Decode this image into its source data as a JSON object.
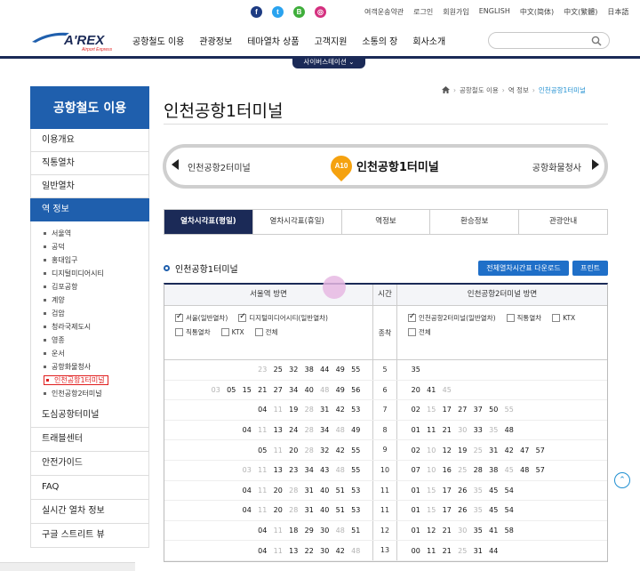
{
  "sns": {
    "facebook": {
      "glyph": "f",
      "color": "#1d3b82"
    },
    "twitter": {
      "glyph": "t",
      "color": "#2aa3ef"
    },
    "blog": {
      "glyph": "B",
      "color": "#3fae3b"
    },
    "instagram": {
      "glyph": "◎",
      "color": "#d4307f"
    }
  },
  "util_links": [
    "여객운송약관",
    "로그인",
    "회원가입",
    "ENGLISH",
    "中文(简体)",
    "中文(繁體)",
    "日本語"
  ],
  "logo": {
    "text": "A'REX",
    "sub": "Airport Express"
  },
  "gnb": [
    "공항철도 이용",
    "관광정보",
    "테마열차 상품",
    "고객지원",
    "소통의 장",
    "회사소개"
  ],
  "search": {
    "placeholder": ""
  },
  "cyber_station": "사이버스테이션",
  "sidebar": {
    "title": "공항철도 이용",
    "items_top": [
      "이용개요",
      "직통열차",
      "일반열차"
    ],
    "active": "역 정보",
    "stations": [
      "서울역",
      "공덕",
      "홍대입구",
      "디지털미디어시티",
      "김포공항",
      "계양",
      "검암",
      "청라국제도시",
      "영종",
      "운서",
      "공항화물청사",
      "인천공항1터미널",
      "인천공항2터미널"
    ],
    "current_station": "인천공항1터미널",
    "items_bottom": [
      "도심공항터미널",
      "트래블센터",
      "안전가이드",
      "FAQ",
      "실시간 열차 정보",
      "구글 스트리트 뷰"
    ]
  },
  "breadcrumb": [
    "공항철도 이용",
    "역 정보",
    "인천공항1터미널"
  ],
  "page_title": "인천공항1터미널",
  "station_nav": {
    "prev": "인천공항2터미널",
    "code": "A10",
    "current": "인천공항1터미널",
    "next": "공항화물청사"
  },
  "tabs": [
    "열차시각표(평일)",
    "열차시각표(휴일)",
    "역정보",
    "환승정보",
    "관광안내"
  ],
  "section_title": "인천공항1터미널",
  "buttons": {
    "download": "전체열차시간표 다운로드",
    "print": "프린트"
  },
  "timetable": {
    "left_header": "서울역 방면",
    "mid_header": "시간",
    "right_header": "인천공항2터미널 방면",
    "mid_filter": "종착",
    "left_filters": [
      {
        "label": "서울(일반열차)",
        "checked": true
      },
      {
        "label": "디지털미디어시티(일반열차)",
        "checked": true
      },
      {
        "label": "직통열차",
        "checked": false
      },
      {
        "label": "KTX",
        "checked": false
      },
      {
        "label": "전체",
        "checked": false
      }
    ],
    "right_filters": [
      {
        "label": "인천공항2터미널(일반열차)",
        "checked": true
      },
      {
        "label": "직통열차",
        "checked": false
      },
      {
        "label": "KTX",
        "checked": false
      },
      {
        "label": "전체",
        "checked": false
      }
    ],
    "rows": [
      {
        "hour": "5",
        "left": [
          {
            "v": "23",
            "g": true
          },
          {
            "v": "25"
          },
          {
            "v": "32"
          },
          {
            "v": "38"
          },
          {
            "v": "44"
          },
          {
            "v": "49"
          },
          {
            "v": "55"
          }
        ],
        "right": [
          {
            "v": "35"
          }
        ]
      },
      {
        "hour": "6",
        "left": [
          {
            "v": "03",
            "g": true
          },
          {
            "v": "05"
          },
          {
            "v": "15"
          },
          {
            "v": "21"
          },
          {
            "v": "27"
          },
          {
            "v": "34"
          },
          {
            "v": "40"
          },
          {
            "v": "48",
            "g": true
          },
          {
            "v": "49"
          },
          {
            "v": "56"
          }
        ],
        "right": [
          {
            "v": "20"
          },
          {
            "v": "41"
          },
          {
            "v": "45",
            "g": true
          }
        ]
      },
      {
        "hour": "7",
        "left": [
          {
            "v": "04"
          },
          {
            "v": "11",
            "g": true
          },
          {
            "v": "19"
          },
          {
            "v": "28",
            "g": true
          },
          {
            "v": "31"
          },
          {
            "v": "42"
          },
          {
            "v": "53"
          }
        ],
        "right": [
          {
            "v": "02"
          },
          {
            "v": "15",
            "g": true
          },
          {
            "v": "17"
          },
          {
            "v": "27"
          },
          {
            "v": "37"
          },
          {
            "v": "50"
          },
          {
            "v": "55",
            "g": true
          }
        ]
      },
      {
        "hour": "8",
        "left": [
          {
            "v": "04"
          },
          {
            "v": "11",
            "g": true
          },
          {
            "v": "13"
          },
          {
            "v": "24"
          },
          {
            "v": "28",
            "g": true
          },
          {
            "v": "34"
          },
          {
            "v": "48",
            "g": true
          },
          {
            "v": "49"
          }
        ],
        "right": [
          {
            "v": "01"
          },
          {
            "v": "11"
          },
          {
            "v": "21"
          },
          {
            "v": "30",
            "g": true
          },
          {
            "v": "33"
          },
          {
            "v": "35",
            "g": true
          },
          {
            "v": "48"
          }
        ]
      },
      {
        "hour": "9",
        "left": [
          {
            "v": "05"
          },
          {
            "v": "11",
            "g": true
          },
          {
            "v": "20"
          },
          {
            "v": "28",
            "g": true
          },
          {
            "v": "32"
          },
          {
            "v": "42"
          },
          {
            "v": "55"
          }
        ],
        "right": [
          {
            "v": "02"
          },
          {
            "v": "10",
            "g": true
          },
          {
            "v": "12"
          },
          {
            "v": "19"
          },
          {
            "v": "25",
            "g": true
          },
          {
            "v": "31"
          },
          {
            "v": "42"
          },
          {
            "v": "47"
          },
          {
            "v": "57"
          }
        ]
      },
      {
        "hour": "10",
        "left": [
          {
            "v": "03",
            "g": true
          },
          {
            "v": "11",
            "g": true
          },
          {
            "v": "13"
          },
          {
            "v": "23"
          },
          {
            "v": "34"
          },
          {
            "v": "43"
          },
          {
            "v": "48",
            "g": true
          },
          {
            "v": "55"
          }
        ],
        "right": [
          {
            "v": "07"
          },
          {
            "v": "10",
            "g": true
          },
          {
            "v": "16"
          },
          {
            "v": "25",
            "g": true
          },
          {
            "v": "28"
          },
          {
            "v": "38"
          },
          {
            "v": "45",
            "g": true
          },
          {
            "v": "48"
          },
          {
            "v": "57"
          }
        ]
      },
      {
        "hour": "11",
        "left": [
          {
            "v": "04"
          },
          {
            "v": "11",
            "g": true
          },
          {
            "v": "20"
          },
          {
            "v": "28",
            "g": true
          },
          {
            "v": "31"
          },
          {
            "v": "40"
          },
          {
            "v": "51"
          },
          {
            "v": "53"
          }
        ],
        "right": [
          {
            "v": "01"
          },
          {
            "v": "15",
            "g": true
          },
          {
            "v": "17"
          },
          {
            "v": "26"
          },
          {
            "v": "35",
            "g": true
          },
          {
            "v": "45"
          },
          {
            "v": "54"
          }
        ]
      },
      {
        "hour": "11",
        "left": [
          {
            "v": "04"
          },
          {
            "v": "11",
            "g": true
          },
          {
            "v": "20"
          },
          {
            "v": "28",
            "g": true
          },
          {
            "v": "31"
          },
          {
            "v": "40"
          },
          {
            "v": "51"
          },
          {
            "v": "53"
          }
        ],
        "right": [
          {
            "v": "01"
          },
          {
            "v": "15",
            "g": true
          },
          {
            "v": "17"
          },
          {
            "v": "26"
          },
          {
            "v": "35",
            "g": true
          },
          {
            "v": "45"
          },
          {
            "v": "54"
          }
        ]
      },
      {
        "hour": "12",
        "left": [
          {
            "v": "04"
          },
          {
            "v": "11",
            "g": true
          },
          {
            "v": "18"
          },
          {
            "v": "29"
          },
          {
            "v": "30"
          },
          {
            "v": "48",
            "g": true
          },
          {
            "v": "51"
          }
        ],
        "right": [
          {
            "v": "01"
          },
          {
            "v": "12"
          },
          {
            "v": "21"
          },
          {
            "v": "30",
            "g": true
          },
          {
            "v": "35"
          },
          {
            "v": "41"
          },
          {
            "v": "58"
          }
        ]
      },
      {
        "hour": "13",
        "left": [
          {
            "v": "04"
          },
          {
            "v": "11",
            "g": true
          },
          {
            "v": "13"
          },
          {
            "v": "22"
          },
          {
            "v": "30"
          },
          {
            "v": "42"
          },
          {
            "v": "48",
            "g": true
          }
        ],
        "right": [
          {
            "v": "00"
          },
          {
            "v": "11"
          },
          {
            "v": "21"
          },
          {
            "v": "25",
            "g": true
          },
          {
            "v": "31"
          },
          {
            "v": "44"
          }
        ]
      }
    ]
  },
  "colors": {
    "brand_blue": "#1f5fad",
    "navy": "#1b2a57",
    "station_orange": "#f5a20f",
    "highlight_red": "#e01e1e"
  }
}
